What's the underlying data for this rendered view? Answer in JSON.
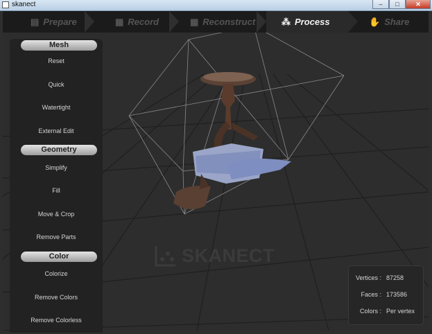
{
  "window": {
    "title": "skanect"
  },
  "nav": {
    "steps": [
      {
        "label": "Prepare",
        "icon": "folder-icon",
        "active": false
      },
      {
        "label": "Record",
        "icon": "film-icon",
        "active": false
      },
      {
        "label": "Reconstruct",
        "icon": "film-icon",
        "active": false
      },
      {
        "label": "Process",
        "icon": "nodes-icon",
        "active": true
      },
      {
        "label": "Share",
        "icon": "thumbs-up-icon",
        "active": false
      }
    ]
  },
  "panel": {
    "mesh": {
      "title": "Mesh",
      "items": [
        "Reset",
        "Quick",
        "Watertight",
        "External Edit"
      ]
    },
    "geometry": {
      "title": "Geometry",
      "items": [
        "Simplify",
        "Fill",
        "Move & Crop",
        "Remove Parts"
      ]
    },
    "color": {
      "title": "Color",
      "items": [
        "Colorize",
        "Remove Colors",
        "Remove Colorless"
      ]
    }
  },
  "stats": {
    "vertices_label": "Vertices :",
    "vertices": "87258",
    "faces_label": "Faces :",
    "faces": "173586",
    "colors_label": "Colors :",
    "colors": "Per vertex"
  },
  "watermark": {
    "text": "SKANECT"
  },
  "colors": {
    "accent": "#f2f2f2",
    "nav_bg": "#1b1b1b",
    "panel_bg": "#222222",
    "viewport_bg": "#2d2d2d"
  }
}
